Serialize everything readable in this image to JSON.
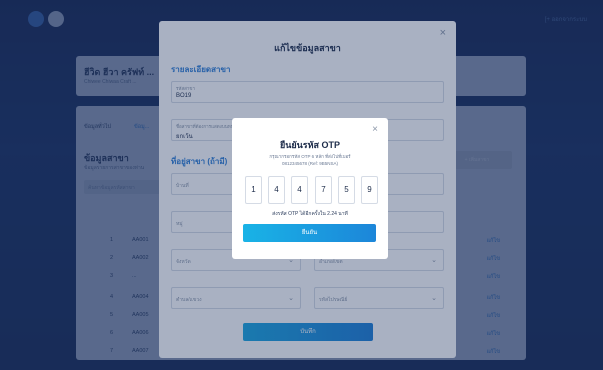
{
  "background": {
    "logout_label": "[+ ออกจากระบบ",
    "header_card": {
      "title": "ฮีวิด ฮีวา ครัฟท์ ...",
      "subtitle": "Chiwee Chiwaa Craft ..."
    },
    "tabs": [
      "ข้อมูลทั่วไป",
      "ข้อมู..."
    ],
    "branch_title": "ข้อมูลสาขา",
    "branch_subtitle": "ข้อมูลรายการสาขาของท่าน",
    "add_button": "+ เพิ่มสาขา",
    "search_placeholder": "ค้นหาข้อมูลรหัสสาขา",
    "rows": [
      {
        "no": "1",
        "code": "AA001",
        "edit": "แก้ไข"
      },
      {
        "no": "2",
        "code": "AA002",
        "edit": "แก้ไข"
      },
      {
        "no": "3",
        "code": "...",
        "edit": "แก้ไข"
      },
      {
        "no": "4",
        "code": "AA004",
        "edit": "แก้ไข"
      },
      {
        "no": "5",
        "code": "AA005",
        "edit": "แก้ไข"
      },
      {
        "no": "6",
        "code": "AA006",
        "edit": "แก้ไข"
      },
      {
        "no": "7",
        "code": "AA007",
        "edit": "แก้ไข"
      }
    ]
  },
  "edit_modal": {
    "title": "แก้ไขข้อมูลสาขา",
    "close": "×",
    "section_detail": "รายละเอียดสาขา",
    "branch_code": {
      "label": "รหัสสาขา",
      "value": "BO19"
    },
    "branch_name": {
      "label": "ชื่อสาขาที่ต้องการแสดงบนหน้า",
      "value": "ยกเว้น"
    },
    "section_address": "ที่อยู่สาขา (ถ้ามี)",
    "house_no_placeholder": "บ้านที่",
    "village_placeholder": "หมู่",
    "province_placeholder": "จังหวัด",
    "district_placeholder": "อำเภอ/เขต",
    "subdistrict_placeholder": "ตำบล/แขวง",
    "postal_placeholder": "รหัสไปรษณีย์",
    "save_label": "บันทึก"
  },
  "otp_modal": {
    "title": "ยืนยันรหัส OTP",
    "close": "×",
    "desc_line1": "กรุณากรอกรหัส OTP 6 หลัก ที่ส่งไปที่เบอร์",
    "desc_line2": "0812345678 (Ref: 9B5NSA)",
    "digits": [
      "1",
      "4",
      "4",
      "7",
      "5",
      "9"
    ],
    "expire_text": "ส่งรหัส OTP ได้อีกครั้งใน 2.24 นาที",
    "confirm_label": "ยืนยัน"
  }
}
